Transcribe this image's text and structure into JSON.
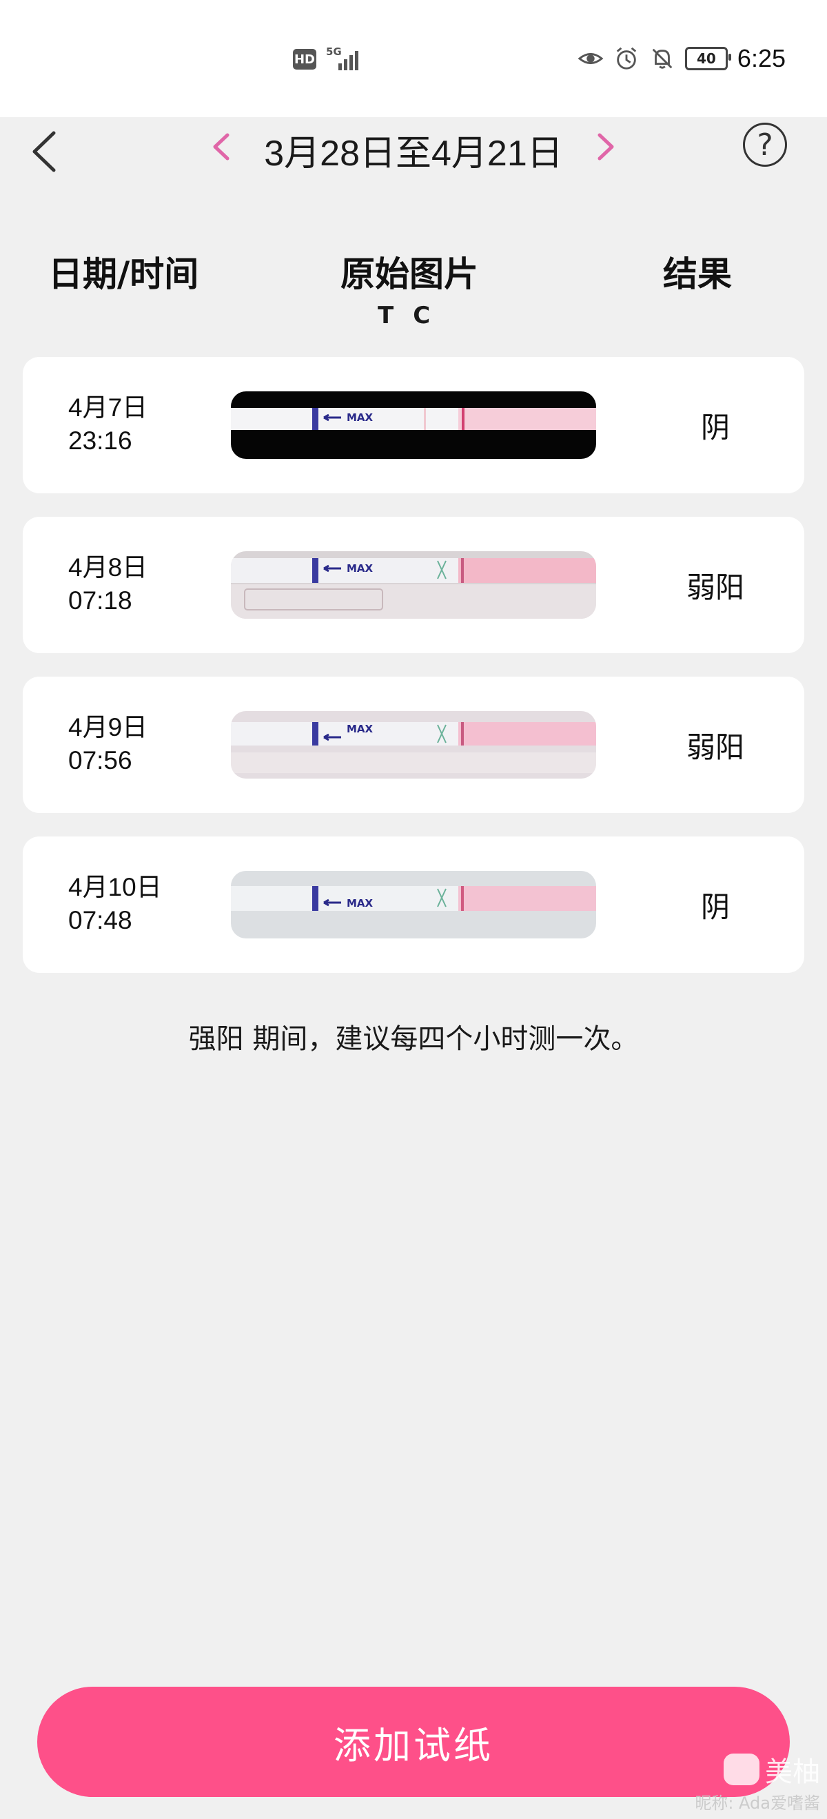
{
  "status_bar": {
    "hd": "HD",
    "network": "5G",
    "battery": "40",
    "time": "6:25"
  },
  "header": {
    "date_range": "3月28日至4月21日",
    "help": "?"
  },
  "columns": {
    "date": "日期/时间",
    "image": "原始图片",
    "t": "T",
    "c": "C",
    "result": "结果"
  },
  "records": [
    {
      "date": "4月7日",
      "time": "23:16",
      "result": "阴",
      "strip_max": "MAX"
    },
    {
      "date": "4月8日",
      "time": "07:18",
      "result": "弱阳",
      "strip_max": "MAX"
    },
    {
      "date": "4月9日",
      "time": "07:56",
      "result": "弱阳",
      "strip_max": "MAX"
    },
    {
      "date": "4月10日",
      "time": "07:48",
      "result": "阴",
      "strip_max": "MAX"
    }
  ],
  "advice": "强阳 期间，建议每四个小时测一次。",
  "add_button": "添加试纸",
  "watermark": {
    "brand": "美柚",
    "nickname": "昵称: Ada爱嗜酱"
  },
  "colors": {
    "accent": "#fe5089",
    "arrow": "#e066a8",
    "background": "#f0f0f0"
  }
}
